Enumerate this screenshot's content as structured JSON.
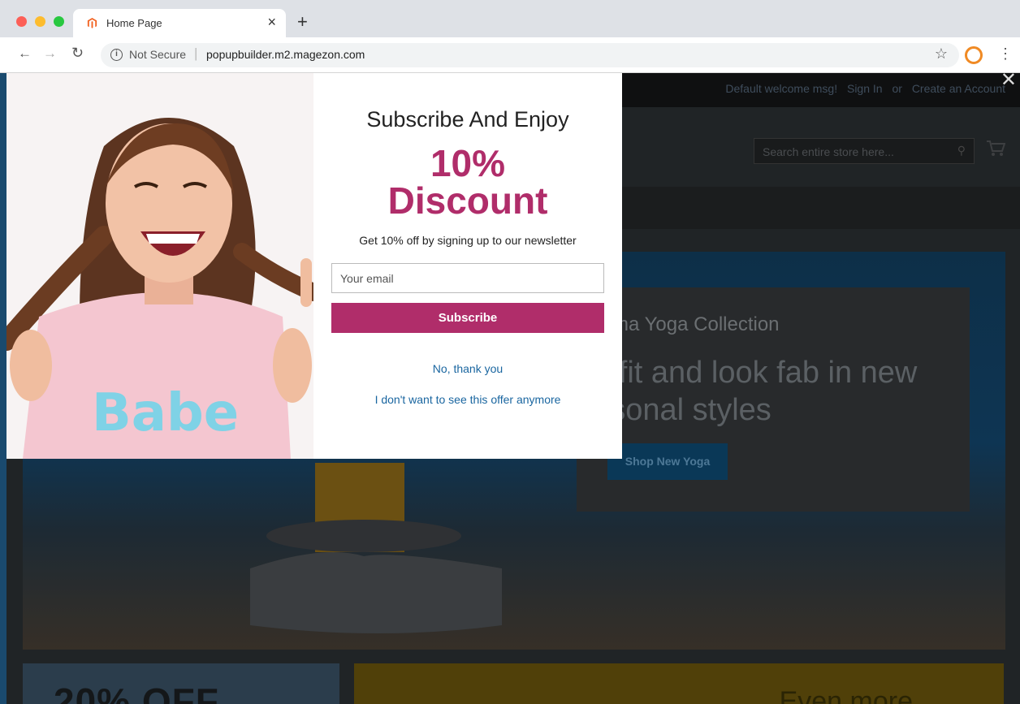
{
  "browser": {
    "tab_title": "Home Page",
    "security_label": "Not Secure",
    "url": "popupbuilder.m2.magezon.com"
  },
  "store": {
    "header_links": [
      "Default welcome msg!",
      "Sign In",
      "or",
      "Create an Account"
    ],
    "search_placeholder": "Search entire store here...",
    "hero": {
      "subtitle": "ew Luma Yoga Collection",
      "title": "Get fit and look fab in new seasonal styles",
      "button_label": "Shop New Yoga"
    },
    "bottom_left_text": "20% OFF",
    "bottom_right_text": "Even more"
  },
  "popup": {
    "heading": "Subscribe And Enjoy",
    "percent": "10%",
    "discount": "Discount",
    "description": "Get 10% off by signing up to our newsletter",
    "email_placeholder": "Your email",
    "subscribe_label": "Subscribe",
    "decline_label": "No, thank you",
    "never_label": "I don't want to see this offer anymore",
    "shirt_text": "Babe"
  },
  "colors": {
    "accent": "#b02d6a",
    "link": "#1a66a0"
  }
}
